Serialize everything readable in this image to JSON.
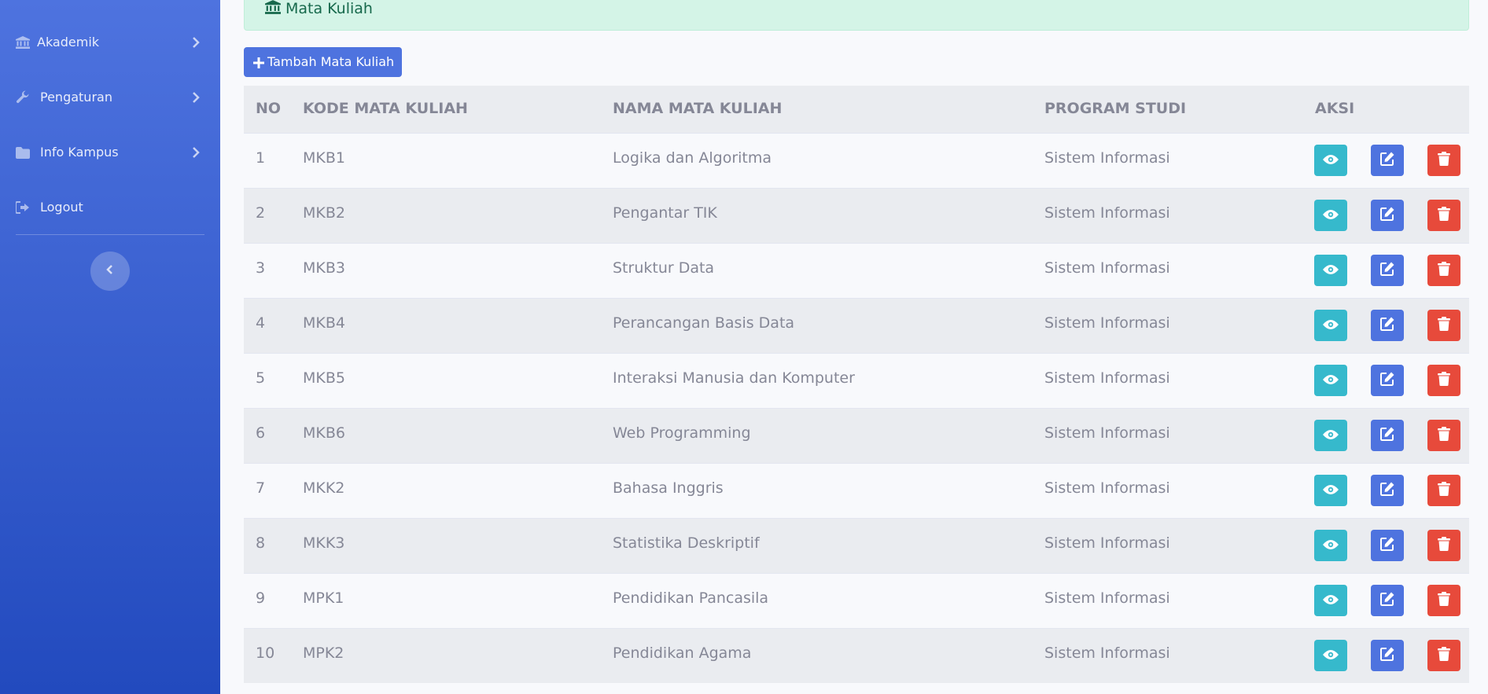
{
  "sidebar": {
    "items": [
      {
        "label": "Akademik",
        "icon": "university-icon",
        "has_chevron": true
      },
      {
        "label": "Pengaturan",
        "icon": "wrench-icon",
        "has_chevron": true
      },
      {
        "label": "Info Kampus",
        "icon": "folder-icon",
        "has_chevron": true
      },
      {
        "label": "Logout",
        "icon": "sign-out-icon",
        "has_chevron": false
      }
    ],
    "toggle_icon": "chevron-left-icon",
    "gradient": [
      "#4e73df",
      "#224abe"
    ]
  },
  "alert": {
    "title": "Mata Kuliah",
    "icon": "university-icon"
  },
  "add_button": {
    "label": "Tambah Mata Kuliah",
    "icon": "plus-icon"
  },
  "table": {
    "headers": [
      "NO",
      "KODE MATA KULIAH",
      "NAMA MATA KULIAH",
      "PROGRAM STUDI",
      "AKSI"
    ],
    "rows": [
      {
        "no": "1",
        "kode": "MKB1",
        "nama": "Logika dan Algoritma",
        "prodi": "Sistem Informasi"
      },
      {
        "no": "2",
        "kode": "MKB2",
        "nama": "Pengantar TIK",
        "prodi": "Sistem Informasi"
      },
      {
        "no": "3",
        "kode": "MKB3",
        "nama": "Struktur Data",
        "prodi": "Sistem Informasi"
      },
      {
        "no": "4",
        "kode": "MKB4",
        "nama": "Perancangan Basis Data",
        "prodi": "Sistem Informasi"
      },
      {
        "no": "5",
        "kode": "MKB5",
        "nama": "Interaksi Manusia dan Komputer",
        "prodi": "Sistem Informasi"
      },
      {
        "no": "6",
        "kode": "MKB6",
        "nama": "Web Programming",
        "prodi": "Sistem Informasi"
      },
      {
        "no": "7",
        "kode": "MKK2",
        "nama": "Bahasa Inggris",
        "prodi": "Sistem Informasi"
      },
      {
        "no": "8",
        "kode": "MKK3",
        "nama": "Statistika Deskriptif",
        "prodi": "Sistem Informasi"
      },
      {
        "no": "9",
        "kode": "MPK1",
        "nama": "Pendidikan Pancasila",
        "prodi": "Sistem Informasi"
      },
      {
        "no": "10",
        "kode": "MPK2",
        "nama": "Pendidikan Agama",
        "prodi": "Sistem Informasi"
      }
    ],
    "actions": {
      "view_icon": "eye-icon",
      "edit_icon": "edit-icon",
      "delete_icon": "trash-icon"
    }
  },
  "colors": {
    "primary": "#4e73df",
    "info": "#36b9cc",
    "danger": "#e74a3b",
    "success_bg": "#d4f4e7",
    "text": "#858796"
  }
}
